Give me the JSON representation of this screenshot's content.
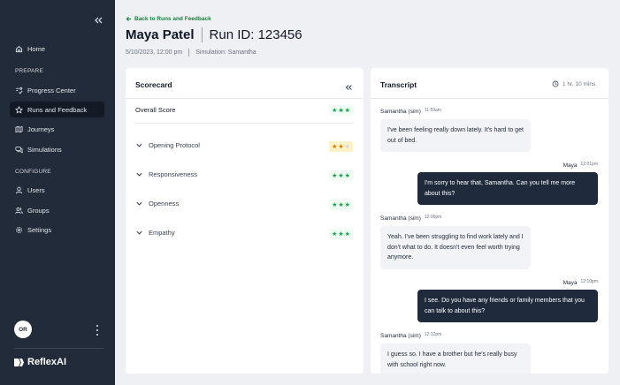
{
  "sidebar": {
    "nav_top": [
      {
        "label": "Home",
        "icon": "home-icon"
      }
    ],
    "sections": [
      {
        "title": "PREPARE",
        "items": [
          {
            "label": "Progress Center",
            "icon": "progress-icon"
          },
          {
            "label": "Runs and Feedback",
            "icon": "star-icon",
            "active": true
          },
          {
            "label": "Journeys",
            "icon": "map-icon"
          },
          {
            "label": "Simulations",
            "icon": "chat-icon"
          }
        ]
      },
      {
        "title": "CONFIGURE",
        "items": [
          {
            "label": "Users",
            "icon": "user-icon"
          },
          {
            "label": "Groups",
            "icon": "group-icon"
          },
          {
            "label": "Settings",
            "icon": "gear-icon"
          }
        ]
      }
    ],
    "avatar_initials": "OR",
    "logo_text": "ReflexAI"
  },
  "header": {
    "back_label": "Back to Runs and Feedback",
    "name": "Maya Patel",
    "run_id": "Run ID: 123456",
    "date": "5/10/2023, 12:00 pm",
    "simulation": "Simulation: Samantha"
  },
  "scorecard": {
    "title": "Scorecard",
    "overall_label": "Overall Score",
    "overall_stars": 3,
    "criteria": [
      {
        "label": "Opening Protocol",
        "stars": 2
      },
      {
        "label": "Responsiveness",
        "stars": 3
      },
      {
        "label": "Openness",
        "stars": 3
      },
      {
        "label": "Empathy",
        "stars": 3
      }
    ],
    "colors": {
      "good": "#16a34a",
      "warn": "#d97706"
    }
  },
  "transcript": {
    "title": "Transcript",
    "duration": "1 hr, 10 mins",
    "messages": [
      {
        "speaker": "Samantha (sim)",
        "time": "11:59am",
        "text": "I've been feeling really down lately. It's hard to get out of bed."
      },
      {
        "speaker": "Maya",
        "time": "12:01pm",
        "text": "I'm sorry to hear that, Samantha. Can you tell me more about this?"
      },
      {
        "speaker": "Samantha (sim)",
        "time": "12:06pm",
        "text": "Yeah. I've been struggling to find work lately and I don't what to do. It doesn't even feel worth trying anymore."
      },
      {
        "speaker": "Maya",
        "time": "12:10pm",
        "text": "I see. Do you have any friends or family members that you can talk to about this?"
      },
      {
        "speaker": "Samantha (sim)",
        "time": "12:12pm",
        "text": "I guess so. I have a brother but he's really busy with school right now."
      }
    ]
  },
  "colors": {
    "sidebar_bg": "#222b39",
    "accent_green": "#15803d",
    "bubble_dark": "#1f2b3c"
  }
}
